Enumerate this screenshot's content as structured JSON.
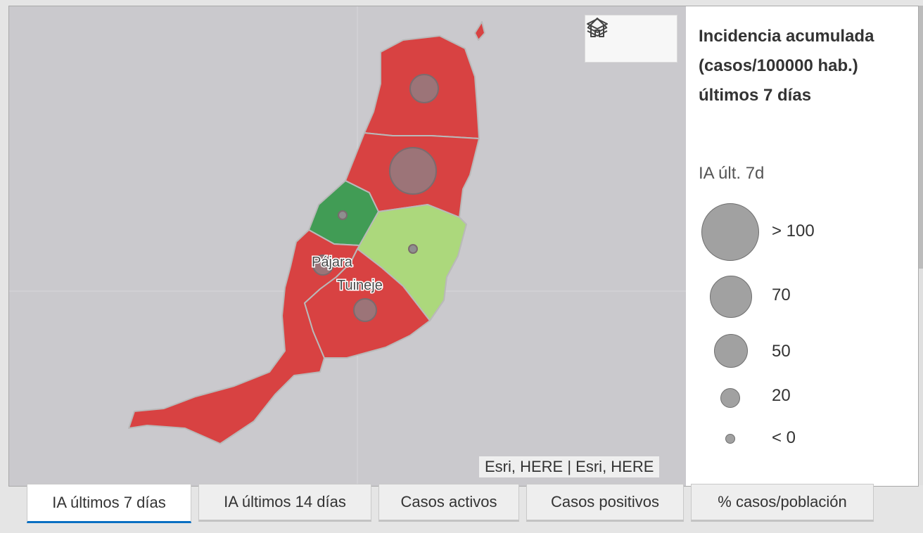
{
  "map": {
    "municipality_labels": [
      "Pájara",
      "Tuineje"
    ],
    "colors": {
      "high": "#d84242",
      "low": "#419c55",
      "mid": "#acd87c",
      "bubble": "#9c7478",
      "background": "#cac9cd"
    },
    "controls": [
      {
        "icon": "home-icon"
      },
      {
        "icon": "layers-icon"
      }
    ],
    "attribution": "Esri, HERE | Esri, HERE"
  },
  "legend": {
    "title": "Incidencia acumulada (casos/100000 hab.) últimos 7 días",
    "subtitle": "IA últ. 7d",
    "items": [
      {
        "label": "> 100"
      },
      {
        "label": "70"
      },
      {
        "label": "50"
      },
      {
        "label": "20"
      },
      {
        "label": "< 0"
      }
    ]
  },
  "tabs": [
    {
      "label": "IA últimos 7 días",
      "active": true
    },
    {
      "label": "IA últimos 14 días",
      "active": false
    },
    {
      "label": "Casos activos",
      "active": false
    },
    {
      "label": "Casos positivos",
      "active": false
    },
    {
      "label": "% casos/población",
      "active": false
    }
  ]
}
